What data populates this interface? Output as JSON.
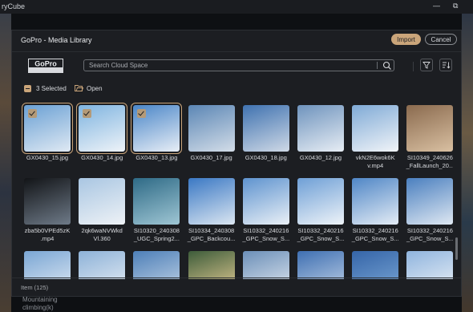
{
  "app": {
    "title": "ryCube",
    "minimize": "—",
    "restore": "⧉"
  },
  "background_text": {
    "line1": "Mountaining",
    "line2": "climbing(k)"
  },
  "dialog": {
    "title": "GoPro - Media Library",
    "import_label": "Import",
    "cancel_label": "Cancel"
  },
  "logo": {
    "text": "GoPro"
  },
  "search": {
    "placeholder": "Search Cloud Space",
    "value": ""
  },
  "selection": {
    "count_label": "3 Selected",
    "open_label": "Open"
  },
  "items": [
    {
      "label": "GX0430_15.jpg",
      "selected": true,
      "colors": [
        "#6aa0d4",
        "#dfe9f3"
      ]
    },
    {
      "label": "GX0430_14.jpg",
      "selected": true,
      "colors": [
        "#7fb4e0",
        "#eef3f8"
      ]
    },
    {
      "label": "GX0430_13.jpg",
      "selected": true,
      "colors": [
        "#4a86c8",
        "#e8eef6"
      ]
    },
    {
      "label": "GX0430_17.jpg",
      "selected": false,
      "colors": [
        "#5b86b5",
        "#d3dde8"
      ]
    },
    {
      "label": "GX0430_18.jpg",
      "selected": false,
      "colors": [
        "#3f72b0",
        "#cfd9e6"
      ]
    },
    {
      "label": "GX0430_12.jpg",
      "selected": false,
      "colors": [
        "#6e93bd",
        "#e7edf4"
      ]
    },
    {
      "label": "vkN2E6wok6K\nv.mp4",
      "selected": false,
      "colors": [
        "#7faad6",
        "#f1f4f8"
      ]
    },
    {
      "label": "SI10349_240626\n_FallLaunch_20...",
      "selected": false,
      "colors": [
        "#8a6a4e",
        "#d9c0a2"
      ]
    },
    {
      "label": "zba5b0VPEd5zK\n.mp4",
      "selected": false,
      "colors": [
        "#121417",
        "#6e7a88"
      ]
    },
    {
      "label": "2qk6waNVWkd\nVl.360",
      "selected": false,
      "colors": [
        "#a9c6e2",
        "#eef2f6"
      ]
    },
    {
      "label": "SI10320_240308\n_UGC_Spring2...",
      "selected": false,
      "colors": [
        "#2e6a86",
        "#9fc6d4"
      ]
    },
    {
      "label": "SI10334_240308\n_GPC_Backcou...",
      "selected": false,
      "colors": [
        "#3a78c4",
        "#dbe6f1"
      ]
    },
    {
      "label": "SI10332_240216\n_GPC_Snow_S...",
      "selected": false,
      "colors": [
        "#5e93cf",
        "#eaf0f6"
      ]
    },
    {
      "label": "SI10332_240216\n_GPC_Snow_S...",
      "selected": false,
      "colors": [
        "#6e9fd6",
        "#eef3f8"
      ]
    },
    {
      "label": "SI10332_240216\n_GPC_Snow_S...",
      "selected": false,
      "colors": [
        "#4f86c6",
        "#e4ecf5"
      ]
    },
    {
      "label": "SI10332_240216\n_GPC_Snow_S...",
      "selected": false,
      "colors": [
        "#4a7fbf",
        "#dfe8f2"
      ]
    },
    {
      "label": "",
      "selected": false,
      "colors": [
        "#7aa6d4",
        "#e6edf5"
      ]
    },
    {
      "label": "",
      "selected": false,
      "colors": [
        "#8db2d8",
        "#edf1f6"
      ]
    },
    {
      "label": "",
      "selected": false,
      "colors": [
        "#4d7fb8",
        "#cbdaea"
      ]
    },
    {
      "label": "",
      "selected": false,
      "colors": [
        "#3d5c3a",
        "#f0d49a"
      ]
    },
    {
      "label": "",
      "selected": false,
      "colors": [
        "#6b8fb8",
        "#e9eef4"
      ]
    },
    {
      "label": "",
      "selected": false,
      "colors": [
        "#3e6fb2",
        "#c9d8ea"
      ]
    },
    {
      "label": "",
      "selected": false,
      "colors": [
        "#3565a8",
        "#7eaad8"
      ]
    },
    {
      "label": "",
      "selected": false,
      "colors": [
        "#8fb4de",
        "#f2f5f8"
      ]
    }
  ],
  "footer": {
    "item_count_label": "Item (125)"
  },
  "colors": {
    "accent": "#caa57a",
    "dialog_bg": "#1c1e22"
  }
}
